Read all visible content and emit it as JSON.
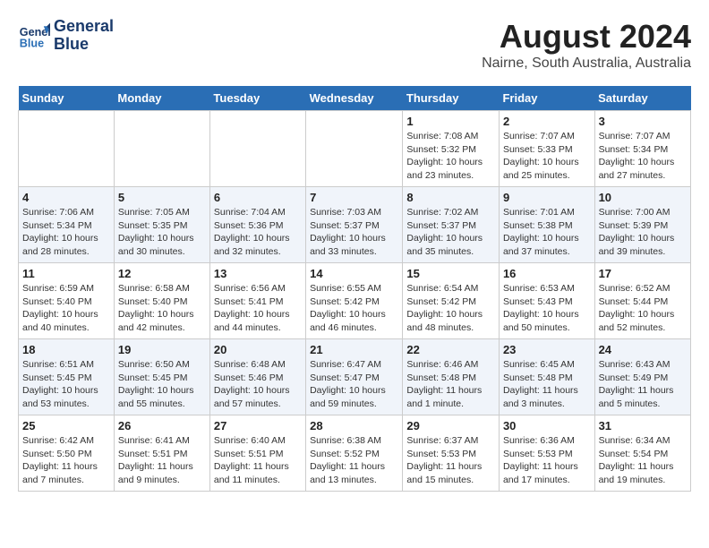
{
  "header": {
    "logo_line1": "General",
    "logo_line2": "Blue",
    "title": "August 2024",
    "subtitle": "Nairne, South Australia, Australia"
  },
  "weekdays": [
    "Sunday",
    "Monday",
    "Tuesday",
    "Wednesday",
    "Thursday",
    "Friday",
    "Saturday"
  ],
  "weeks": [
    [
      {
        "day": "",
        "info": ""
      },
      {
        "day": "",
        "info": ""
      },
      {
        "day": "",
        "info": ""
      },
      {
        "day": "",
        "info": ""
      },
      {
        "day": "1",
        "info": "Sunrise: 7:08 AM\nSunset: 5:32 PM\nDaylight: 10 hours\nand 23 minutes."
      },
      {
        "day": "2",
        "info": "Sunrise: 7:07 AM\nSunset: 5:33 PM\nDaylight: 10 hours\nand 25 minutes."
      },
      {
        "day": "3",
        "info": "Sunrise: 7:07 AM\nSunset: 5:34 PM\nDaylight: 10 hours\nand 27 minutes."
      }
    ],
    [
      {
        "day": "4",
        "info": "Sunrise: 7:06 AM\nSunset: 5:34 PM\nDaylight: 10 hours\nand 28 minutes."
      },
      {
        "day": "5",
        "info": "Sunrise: 7:05 AM\nSunset: 5:35 PM\nDaylight: 10 hours\nand 30 minutes."
      },
      {
        "day": "6",
        "info": "Sunrise: 7:04 AM\nSunset: 5:36 PM\nDaylight: 10 hours\nand 32 minutes."
      },
      {
        "day": "7",
        "info": "Sunrise: 7:03 AM\nSunset: 5:37 PM\nDaylight: 10 hours\nand 33 minutes."
      },
      {
        "day": "8",
        "info": "Sunrise: 7:02 AM\nSunset: 5:37 PM\nDaylight: 10 hours\nand 35 minutes."
      },
      {
        "day": "9",
        "info": "Sunrise: 7:01 AM\nSunset: 5:38 PM\nDaylight: 10 hours\nand 37 minutes."
      },
      {
        "day": "10",
        "info": "Sunrise: 7:00 AM\nSunset: 5:39 PM\nDaylight: 10 hours\nand 39 minutes."
      }
    ],
    [
      {
        "day": "11",
        "info": "Sunrise: 6:59 AM\nSunset: 5:40 PM\nDaylight: 10 hours\nand 40 minutes."
      },
      {
        "day": "12",
        "info": "Sunrise: 6:58 AM\nSunset: 5:40 PM\nDaylight: 10 hours\nand 42 minutes."
      },
      {
        "day": "13",
        "info": "Sunrise: 6:56 AM\nSunset: 5:41 PM\nDaylight: 10 hours\nand 44 minutes."
      },
      {
        "day": "14",
        "info": "Sunrise: 6:55 AM\nSunset: 5:42 PM\nDaylight: 10 hours\nand 46 minutes."
      },
      {
        "day": "15",
        "info": "Sunrise: 6:54 AM\nSunset: 5:42 PM\nDaylight: 10 hours\nand 48 minutes."
      },
      {
        "day": "16",
        "info": "Sunrise: 6:53 AM\nSunset: 5:43 PM\nDaylight: 10 hours\nand 50 minutes."
      },
      {
        "day": "17",
        "info": "Sunrise: 6:52 AM\nSunset: 5:44 PM\nDaylight: 10 hours\nand 52 minutes."
      }
    ],
    [
      {
        "day": "18",
        "info": "Sunrise: 6:51 AM\nSunset: 5:45 PM\nDaylight: 10 hours\nand 53 minutes."
      },
      {
        "day": "19",
        "info": "Sunrise: 6:50 AM\nSunset: 5:45 PM\nDaylight: 10 hours\nand 55 minutes."
      },
      {
        "day": "20",
        "info": "Sunrise: 6:48 AM\nSunset: 5:46 PM\nDaylight: 10 hours\nand 57 minutes."
      },
      {
        "day": "21",
        "info": "Sunrise: 6:47 AM\nSunset: 5:47 PM\nDaylight: 10 hours\nand 59 minutes."
      },
      {
        "day": "22",
        "info": "Sunrise: 6:46 AM\nSunset: 5:48 PM\nDaylight: 11 hours\nand 1 minute."
      },
      {
        "day": "23",
        "info": "Sunrise: 6:45 AM\nSunset: 5:48 PM\nDaylight: 11 hours\nand 3 minutes."
      },
      {
        "day": "24",
        "info": "Sunrise: 6:43 AM\nSunset: 5:49 PM\nDaylight: 11 hours\nand 5 minutes."
      }
    ],
    [
      {
        "day": "25",
        "info": "Sunrise: 6:42 AM\nSunset: 5:50 PM\nDaylight: 11 hours\nand 7 minutes."
      },
      {
        "day": "26",
        "info": "Sunrise: 6:41 AM\nSunset: 5:51 PM\nDaylight: 11 hours\nand 9 minutes."
      },
      {
        "day": "27",
        "info": "Sunrise: 6:40 AM\nSunset: 5:51 PM\nDaylight: 11 hours\nand 11 minutes."
      },
      {
        "day": "28",
        "info": "Sunrise: 6:38 AM\nSunset: 5:52 PM\nDaylight: 11 hours\nand 13 minutes."
      },
      {
        "day": "29",
        "info": "Sunrise: 6:37 AM\nSunset: 5:53 PM\nDaylight: 11 hours\nand 15 minutes."
      },
      {
        "day": "30",
        "info": "Sunrise: 6:36 AM\nSunset: 5:53 PM\nDaylight: 11 hours\nand 17 minutes."
      },
      {
        "day": "31",
        "info": "Sunrise: 6:34 AM\nSunset: 5:54 PM\nDaylight: 11 hours\nand 19 minutes."
      }
    ]
  ]
}
